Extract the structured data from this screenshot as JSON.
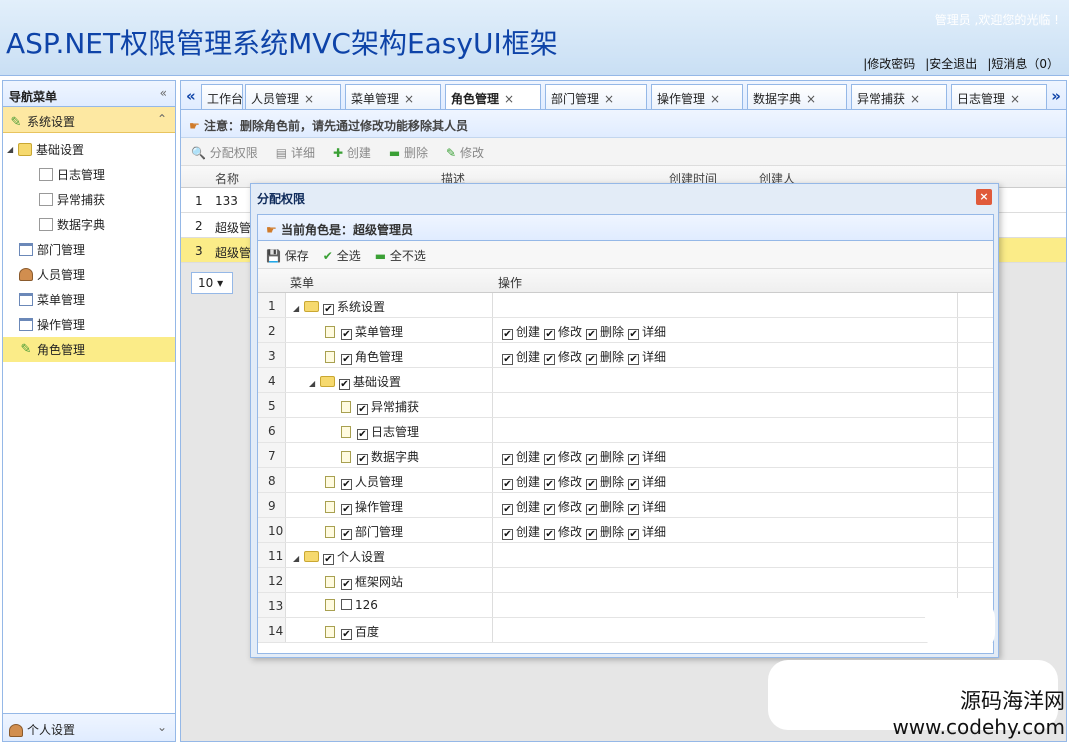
{
  "header": {
    "title": "ASP.NET权限管理系统MVC架构EasyUI框架",
    "welcome": "管理员 ,欢迎您的光临 !",
    "links": [
      "|修改密码",
      "|安全退出",
      "|短消息（0）"
    ]
  },
  "sidebar": {
    "title": "导航菜单",
    "collapse": "«",
    "section": "系统设置",
    "section_toggle": "⌃",
    "items": [
      {
        "label": "基础设置",
        "level": 0
      },
      {
        "label": "日志管理",
        "level": 1
      },
      {
        "label": "异常捕获",
        "level": 1
      },
      {
        "label": "数据字典",
        "level": 1
      },
      {
        "label": "部门管理",
        "level": 0
      },
      {
        "label": "人员管理",
        "level": 0
      },
      {
        "label": "菜单管理",
        "level": 0
      },
      {
        "label": "操作管理",
        "level": 0
      },
      {
        "label": "角色管理",
        "level": 0
      }
    ],
    "footer": "个人设置",
    "footer_toggle": "⌄"
  },
  "tabs": {
    "prev": "«",
    "next": "»",
    "items": [
      "工作台",
      "人员管理",
      "菜单管理",
      "角色管理",
      "部门管理",
      "操作管理",
      "数据字典",
      "异常捕获",
      "日志管理"
    ],
    "active": "角色管理"
  },
  "main": {
    "note": "注意：删除角色前，请先通过修改功能移除其人员",
    "toolbar": [
      "分配权限",
      "详细",
      "创建",
      "删除",
      "修改"
    ],
    "grid": {
      "headers": [
        "名称",
        "描述",
        "创建时间",
        "创建人"
      ],
      "rows": [
        {
          "num": "1",
          "name": "133"
        },
        {
          "num": "2",
          "name": "超级管"
        },
        {
          "num": "3",
          "name": "超级管"
        }
      ]
    },
    "page_size": "10"
  },
  "dialog": {
    "title": "分配权限",
    "close": "×",
    "role_label": "当前角色是：超级管理员",
    "toolbar": [
      "保存",
      "全选",
      "全不选"
    ],
    "headers": [
      "菜单",
      "操作"
    ],
    "rows": [
      {
        "num": "1",
        "label": "系统设置",
        "level": 0,
        "folder": true,
        "checked": true,
        "ops": []
      },
      {
        "num": "2",
        "label": "菜单管理",
        "level": 1,
        "folder": false,
        "checked": true,
        "ops": [
          "创建",
          "修改",
          "删除",
          "详细"
        ]
      },
      {
        "num": "3",
        "label": "角色管理",
        "level": 1,
        "folder": false,
        "checked": true,
        "ops": [
          "创建",
          "修改",
          "删除",
          "详细"
        ]
      },
      {
        "num": "4",
        "label": "基础设置",
        "level": 1,
        "folder": true,
        "checked": true,
        "ops": []
      },
      {
        "num": "5",
        "label": "异常捕获",
        "level": 2,
        "folder": false,
        "checked": true,
        "ops": []
      },
      {
        "num": "6",
        "label": "日志管理",
        "level": 2,
        "folder": false,
        "checked": true,
        "ops": []
      },
      {
        "num": "7",
        "label": "数据字典",
        "level": 2,
        "folder": false,
        "checked": true,
        "ops": [
          "创建",
          "修改",
          "删除",
          "详细"
        ]
      },
      {
        "num": "8",
        "label": "人员管理",
        "level": 1,
        "folder": false,
        "checked": true,
        "ops": [
          "创建",
          "修改",
          "删除",
          "详细"
        ]
      },
      {
        "num": "9",
        "label": "操作管理",
        "level": 1,
        "folder": false,
        "checked": true,
        "ops": [
          "创建",
          "修改",
          "删除",
          "详细"
        ]
      },
      {
        "num": "10",
        "label": "部门管理",
        "level": 1,
        "folder": false,
        "checked": true,
        "ops": [
          "创建",
          "修改",
          "删除",
          "详细"
        ]
      },
      {
        "num": "11",
        "label": "个人设置",
        "level": 0,
        "folder": true,
        "checked": true,
        "ops": []
      },
      {
        "num": "12",
        "label": "框架网站",
        "level": 1,
        "folder": false,
        "checked": true,
        "ops": []
      },
      {
        "num": "13",
        "label": "126",
        "level": 1,
        "folder": false,
        "checked": false,
        "ops": []
      },
      {
        "num": "14",
        "label": "百度",
        "level": 1,
        "folder": false,
        "checked": true,
        "ops": []
      }
    ]
  },
  "watermark": {
    "line1": "源码海洋网",
    "line2": "www.codehy.com"
  }
}
